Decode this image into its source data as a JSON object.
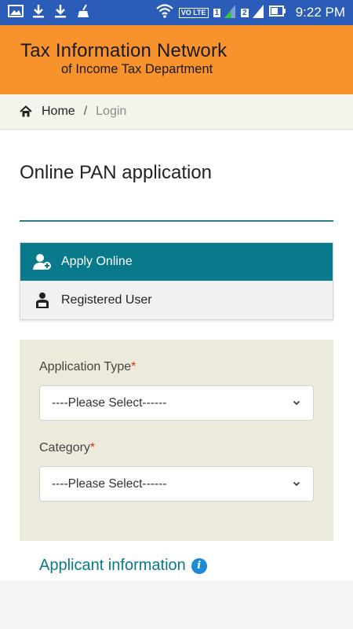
{
  "status_bar": {
    "time": "9:22 PM",
    "volte": "VO LTE",
    "sim1": "1",
    "sim2": "2",
    "icons": [
      "image-icon",
      "download-icon",
      "download-icon",
      "cleaner-icon",
      "wifi-icon",
      "signal-icon",
      "battery-icon"
    ]
  },
  "header": {
    "title": "Tax Information Network",
    "subtitle": "of Income Tax Department"
  },
  "breadcrumb": {
    "home": "Home",
    "separator": "/",
    "current": "Login"
  },
  "page": {
    "title": "Online PAN application"
  },
  "menu": {
    "items": [
      {
        "label": "Apply Online",
        "icon": "add-user-icon",
        "active": true
      },
      {
        "label": "Registered User",
        "icon": "registered-user-icon",
        "active": false
      }
    ]
  },
  "form": {
    "application_type": {
      "label": "Application Type",
      "required_mark": "*",
      "value": "----Please Select------"
    },
    "category": {
      "label": "Category",
      "required_mark": "*",
      "value": "----Please Select------"
    }
  },
  "applicant_section": {
    "title": "Applicant information",
    "info_glyph": "i"
  },
  "colors": {
    "status_bar": "#2b5db8",
    "header": "#f7922d",
    "accent_teal": "#087a8c",
    "form_panel": "#ecebdb",
    "required": "#d0341b",
    "info_blue": "#1f8ad6"
  }
}
